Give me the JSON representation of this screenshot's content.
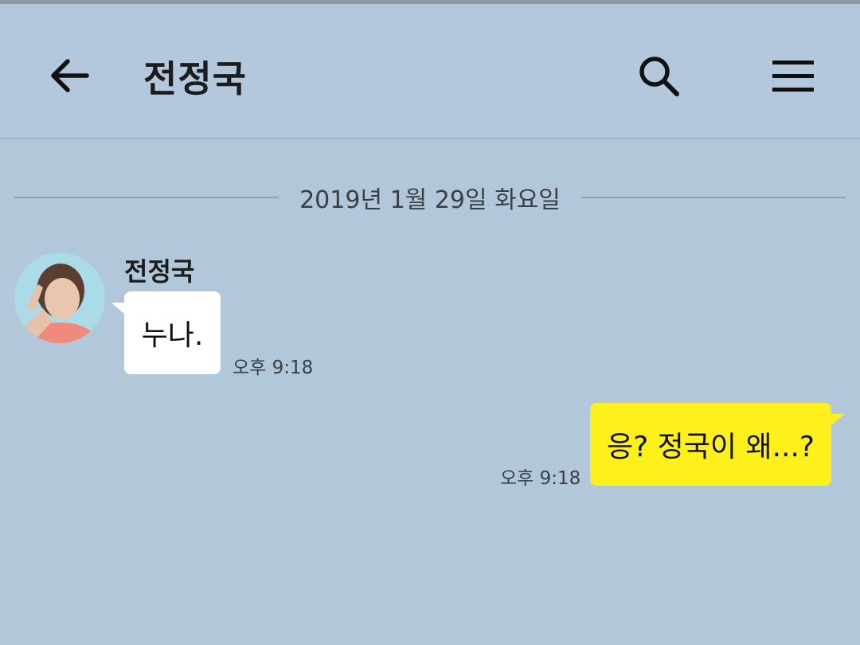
{
  "header": {
    "title": "전정국",
    "back_icon": "arrow-left-icon",
    "search_icon": "search-icon",
    "menu_icon": "hamburger-menu-icon"
  },
  "date_divider": {
    "text": "2019년 1월 29일 화요일"
  },
  "messages": [
    {
      "direction": "incoming",
      "sender": "전정국",
      "text": "누나.",
      "time": "오후 9:18"
    },
    {
      "direction": "outgoing",
      "text": "응? 정국이 왜...?",
      "time": "오후 9:18"
    }
  ],
  "colors": {
    "background": "#b2c7da",
    "outgoing_bubble": "#fef01b",
    "incoming_bubble": "#ffffff"
  }
}
